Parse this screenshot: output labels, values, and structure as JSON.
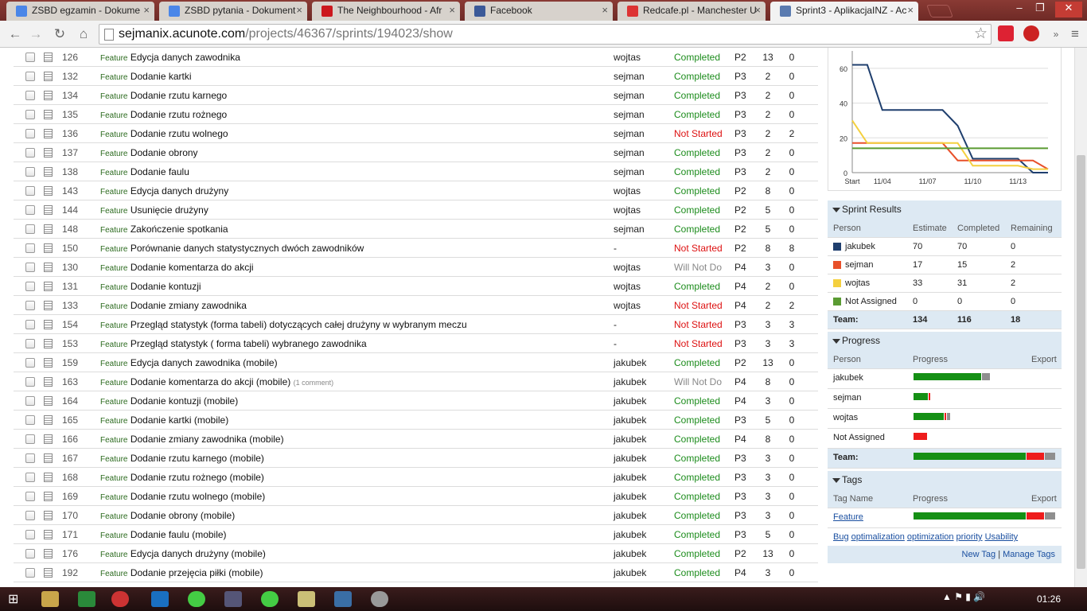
{
  "tabs": [
    {
      "label": "ZSBD egzamin - Dokume",
      "color": "#4a86e8",
      "active": false
    },
    {
      "label": "ZSBD pytania - Dokument",
      "color": "#4a86e8",
      "active": false
    },
    {
      "label": "The Neighbourhood - Afr",
      "color": "#cc181e",
      "active": false
    },
    {
      "label": "Facebook",
      "color": "#3b5998",
      "active": false
    },
    {
      "label": "Redcafe.pl - Manchester U",
      "color": "#d33",
      "active": false
    },
    {
      "label": "Sprint3 - AplikacjaINZ - Ac",
      "color": "#5a7bb0",
      "active": true
    }
  ],
  "toolbar": {
    "url_host": "sejmanix.acunote.com",
    "url_path": "/projects/46367/sprints/194023/show"
  },
  "tasks": [
    {
      "num": "126",
      "tag": "Feature",
      "desc": "Edycja danych zawodnika",
      "comment": "",
      "owner": "wojtas",
      "status": "Completed",
      "s": "completed",
      "pr": "P2",
      "est": "13",
      "rem": "0"
    },
    {
      "num": "132",
      "tag": "Feature",
      "desc": "Dodanie kartki",
      "comment": "",
      "owner": "sejman",
      "status": "Completed",
      "s": "completed",
      "pr": "P3",
      "est": "2",
      "rem": "0"
    },
    {
      "num": "134",
      "tag": "Feature",
      "desc": "Dodanie rzutu karnego",
      "comment": "",
      "owner": "sejman",
      "status": "Completed",
      "s": "completed",
      "pr": "P3",
      "est": "2",
      "rem": "0"
    },
    {
      "num": "135",
      "tag": "Feature",
      "desc": "Dodanie rzutu rożnego",
      "comment": "",
      "owner": "sejman",
      "status": "Completed",
      "s": "completed",
      "pr": "P3",
      "est": "2",
      "rem": "0"
    },
    {
      "num": "136",
      "tag": "Feature",
      "desc": "Dodanie rzutu wolnego",
      "comment": "",
      "owner": "sejman",
      "status": "Not Started",
      "s": "notstarted",
      "pr": "P3",
      "est": "2",
      "rem": "2"
    },
    {
      "num": "137",
      "tag": "Feature",
      "desc": "Dodanie obrony",
      "comment": "",
      "owner": "sejman",
      "status": "Completed",
      "s": "completed",
      "pr": "P3",
      "est": "2",
      "rem": "0"
    },
    {
      "num": "138",
      "tag": "Feature",
      "desc": "Dodanie faulu",
      "comment": "",
      "owner": "sejman",
      "status": "Completed",
      "s": "completed",
      "pr": "P3",
      "est": "2",
      "rem": "0"
    },
    {
      "num": "143",
      "tag": "Feature",
      "desc": "Edycja danych drużyny",
      "comment": "",
      "owner": "wojtas",
      "status": "Completed",
      "s": "completed",
      "pr": "P2",
      "est": "8",
      "rem": "0"
    },
    {
      "num": "144",
      "tag": "Feature",
      "desc": "Usunięcie drużyny",
      "comment": "",
      "owner": "wojtas",
      "status": "Completed",
      "s": "completed",
      "pr": "P2",
      "est": "5",
      "rem": "0"
    },
    {
      "num": "148",
      "tag": "Feature",
      "desc": "Zakończenie spotkania",
      "comment": "",
      "owner": "sejman",
      "status": "Completed",
      "s": "completed",
      "pr": "P2",
      "est": "5",
      "rem": "0"
    },
    {
      "num": "150",
      "tag": "Feature",
      "desc": "Porównanie danych statystycznych dwóch zawodników",
      "comment": "",
      "owner": "-",
      "status": "Not Started",
      "s": "notstarted",
      "pr": "P2",
      "est": "8",
      "rem": "8"
    },
    {
      "num": "130",
      "tag": "Feature",
      "desc": "Dodanie komentarza do akcji",
      "comment": "",
      "owner": "wojtas",
      "status": "Will Not Do",
      "s": "willnotdo",
      "pr": "P4",
      "est": "3",
      "rem": "0"
    },
    {
      "num": "131",
      "tag": "Feature",
      "desc": "Dodanie kontuzji",
      "comment": "",
      "owner": "wojtas",
      "status": "Completed",
      "s": "completed",
      "pr": "P4",
      "est": "2",
      "rem": "0"
    },
    {
      "num": "133",
      "tag": "Feature",
      "desc": "Dodanie zmiany zawodnika",
      "comment": "",
      "owner": "wojtas",
      "status": "Not Started",
      "s": "notstarted",
      "pr": "P4",
      "est": "2",
      "rem": "2"
    },
    {
      "num": "154",
      "tag": "Feature",
      "desc": "Przegląd statystyk (forma tabeli) dotyczących całej drużyny w wybranym meczu",
      "comment": "",
      "owner": "-",
      "status": "Not Started",
      "s": "notstarted",
      "pr": "P3",
      "est": "3",
      "rem": "3"
    },
    {
      "num": "153",
      "tag": "Feature",
      "desc": "Przegląd statystyk ( forma tabeli) wybranego zawodnika",
      "comment": "",
      "owner": "-",
      "status": "Not Started",
      "s": "notstarted",
      "pr": "P3",
      "est": "3",
      "rem": "3"
    },
    {
      "num": "159",
      "tag": "Feature",
      "desc": "Edycja danych zawodnika (mobile)",
      "comment": "",
      "owner": "jakubek",
      "status": "Completed",
      "s": "completed",
      "pr": "P2",
      "est": "13",
      "rem": "0"
    },
    {
      "num": "163",
      "tag": "Feature",
      "desc": "Dodanie komentarza do akcji (mobile)",
      "comment": "(1 comment)",
      "owner": "jakubek",
      "status": "Will Not Do",
      "s": "willnotdo",
      "pr": "P4",
      "est": "8",
      "rem": "0"
    },
    {
      "num": "164",
      "tag": "Feature",
      "desc": "Dodanie kontuzji (mobile)",
      "comment": "",
      "owner": "jakubek",
      "status": "Completed",
      "s": "completed",
      "pr": "P4",
      "est": "3",
      "rem": "0"
    },
    {
      "num": "165",
      "tag": "Feature",
      "desc": "Dodanie kartki (mobile)",
      "comment": "",
      "owner": "jakubek",
      "status": "Completed",
      "s": "completed",
      "pr": "P3",
      "est": "5",
      "rem": "0"
    },
    {
      "num": "166",
      "tag": "Feature",
      "desc": "Dodanie zmiany zawodnika (mobile)",
      "comment": "",
      "owner": "jakubek",
      "status": "Completed",
      "s": "completed",
      "pr": "P4",
      "est": "8",
      "rem": "0"
    },
    {
      "num": "167",
      "tag": "Feature",
      "desc": "Dodanie rzutu karnego (mobile)",
      "comment": "",
      "owner": "jakubek",
      "status": "Completed",
      "s": "completed",
      "pr": "P3",
      "est": "3",
      "rem": "0"
    },
    {
      "num": "168",
      "tag": "Feature",
      "desc": "Dodanie rzutu rożnego (mobile)",
      "comment": "",
      "owner": "jakubek",
      "status": "Completed",
      "s": "completed",
      "pr": "P3",
      "est": "3",
      "rem": "0"
    },
    {
      "num": "169",
      "tag": "Feature",
      "desc": "Dodanie rzutu wolnego (mobile)",
      "comment": "",
      "owner": "jakubek",
      "status": "Completed",
      "s": "completed",
      "pr": "P3",
      "est": "3",
      "rem": "0"
    },
    {
      "num": "170",
      "tag": "Feature",
      "desc": "Dodanie obrony (mobile)",
      "comment": "",
      "owner": "jakubek",
      "status": "Completed",
      "s": "completed",
      "pr": "P3",
      "est": "3",
      "rem": "0"
    },
    {
      "num": "171",
      "tag": "Feature",
      "desc": "Dodanie faulu (mobile)",
      "comment": "",
      "owner": "jakubek",
      "status": "Completed",
      "s": "completed",
      "pr": "P3",
      "est": "5",
      "rem": "0"
    },
    {
      "num": "176",
      "tag": "Feature",
      "desc": "Edycja danych drużyny (mobile)",
      "comment": "",
      "owner": "jakubek",
      "status": "Completed",
      "s": "completed",
      "pr": "P2",
      "est": "13",
      "rem": "0"
    },
    {
      "num": "192",
      "tag": "Feature",
      "desc": "Dodanie przejęcia piłki (mobile)",
      "comment": "",
      "owner": "jakubek",
      "status": "Completed",
      "s": "completed",
      "pr": "P4",
      "est": "3",
      "rem": "0"
    }
  ],
  "chart_data": {
    "type": "line",
    "x": [
      "Start",
      "11/03",
      "11/04",
      "11/05",
      "11/06",
      "11/07",
      "11/08",
      "11/09",
      "11/10",
      "11/11",
      "11/12",
      "11/13",
      "11/14",
      "11/15"
    ],
    "xticks": [
      "Start",
      "11/04",
      "11/07",
      "11/10",
      "11/13"
    ],
    "yticks": [
      "0",
      "20",
      "40",
      "60"
    ],
    "ylim": [
      0,
      70
    ],
    "series": [
      {
        "color": "#1f3f6e",
        "values": [
          62,
          62,
          36,
          36,
          36,
          36,
          36,
          27,
          8,
          8,
          8,
          8,
          0,
          0
        ]
      },
      {
        "color": "#e8502a",
        "values": [
          17,
          17,
          17,
          17,
          17,
          17,
          17,
          7,
          7,
          7,
          7,
          7,
          7,
          2
        ]
      },
      {
        "color": "#f4d03f",
        "values": [
          30,
          17,
          17,
          17,
          17,
          17,
          17,
          17,
          4,
          4,
          4,
          4,
          2,
          2
        ]
      },
      {
        "color": "#5a9b32",
        "values": [
          14,
          14,
          14,
          14,
          14,
          14,
          14,
          14,
          14,
          14,
          14,
          14,
          14,
          14
        ]
      }
    ]
  },
  "sprint_results": {
    "heading": "Sprint Results",
    "cols": [
      "Person",
      "Estimate",
      "Completed",
      "Remaining"
    ],
    "rows": [
      {
        "person": "jakubek",
        "color": "#1f3f6e",
        "est": "70",
        "comp": "70",
        "rem": "0"
      },
      {
        "person": "sejman",
        "color": "#e8502a",
        "est": "17",
        "comp": "15",
        "rem": "2"
      },
      {
        "person": "wojtas",
        "color": "#f4d03f",
        "est": "33",
        "comp": "31",
        "rem": "2"
      },
      {
        "person": "Not Assigned",
        "color": "#5a9b32",
        "est": "0",
        "comp": "0",
        "rem": "0"
      }
    ],
    "team": {
      "label": "Team:",
      "est": "134",
      "comp": "116",
      "rem": "18"
    }
  },
  "progress": {
    "heading": "Progress",
    "cols": [
      "Person",
      "Progress",
      "Export"
    ],
    "rows": [
      {
        "person": "jakubek",
        "done": 70,
        "notstarted": 0,
        "wnd": 8
      },
      {
        "person": "sejman",
        "done": 15,
        "notstarted": 2,
        "wnd": 0
      },
      {
        "person": "wojtas",
        "done": 31,
        "notstarted": 2,
        "wnd": 3
      },
      {
        "person": "Not Assigned",
        "done": 0,
        "notstarted": 14,
        "wnd": 0
      }
    ],
    "team": {
      "label": "Team:",
      "done": 116,
      "notstarted": 18,
      "wnd": 11
    }
  },
  "tags": {
    "heading": "Tags",
    "cols": [
      "Tag Name",
      "Progress",
      "Export"
    ],
    "rows": [
      {
        "name": "Feature",
        "done": 116,
        "notstarted": 18,
        "wnd": 11
      }
    ],
    "links": [
      "Bug",
      "optimalization",
      "optimization",
      "priority",
      "Usability"
    ],
    "new_tag": "New Tag",
    "sep": "|",
    "manage": "Manage Tags"
  },
  "taskbar": {
    "clock": "01:26"
  }
}
